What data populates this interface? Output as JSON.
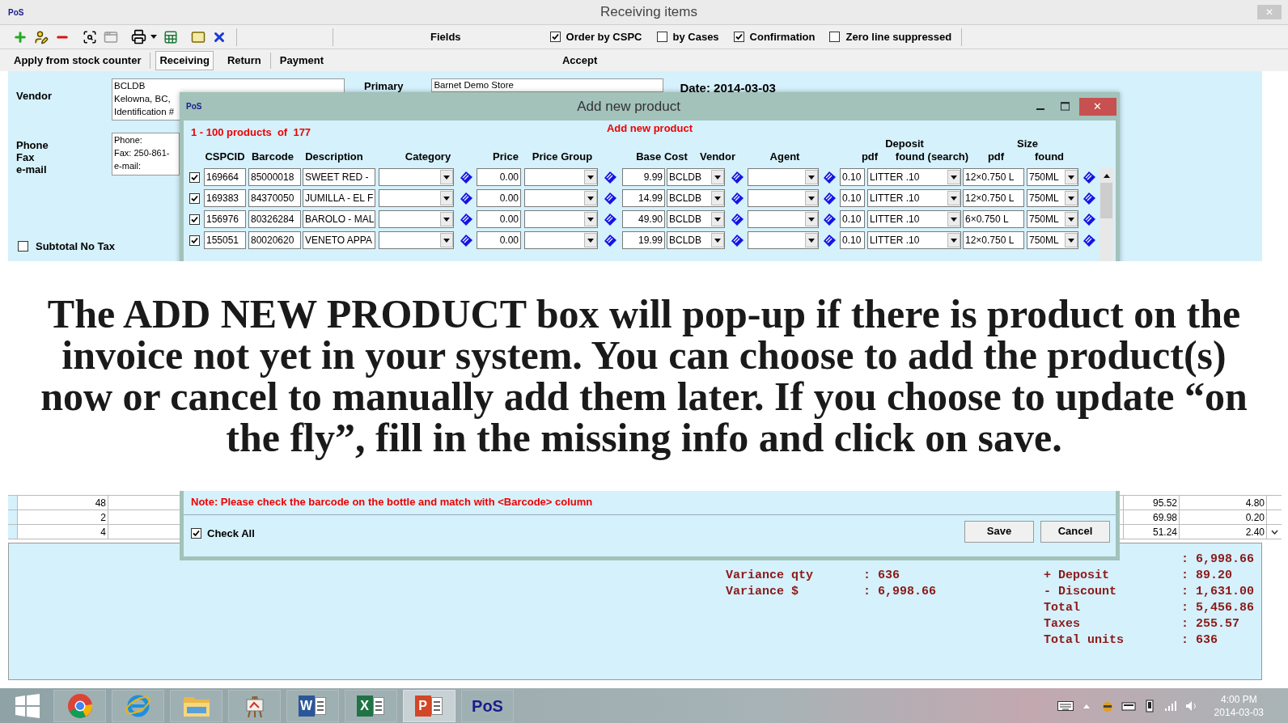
{
  "window": {
    "logo": "PoS",
    "title": "Receiving items",
    "close": "✕"
  },
  "toolbar": {
    "fields_label": "Fields",
    "options": [
      {
        "label": "Order by CSPC",
        "checked": true
      },
      {
        "label": "by Cases",
        "checked": false
      },
      {
        "label": "Confirmation",
        "checked": true
      },
      {
        "label": "Zero line suppressed",
        "checked": false
      }
    ]
  },
  "tabs": [
    {
      "label": "Apply from stock counter",
      "selected": false
    },
    {
      "label": "Receiving",
      "selected": true
    },
    {
      "label": "Return",
      "selected": false
    },
    {
      "label": "Payment",
      "selected": false
    }
  ],
  "accept_label": "Accept",
  "vendor": {
    "label": "Vendor",
    "lines": [
      "BCLDB",
      "Kelowna, BC,",
      "Identification #"
    ]
  },
  "primary": {
    "label": "Primary",
    "value": "Barnet Demo Store"
  },
  "date": "Date: 2014-03-03",
  "contact": {
    "labels": [
      "Phone",
      "Fax",
      "e-mail"
    ],
    "lines": [
      "Phone:",
      "Fax: 250-861-",
      "e-mail:"
    ]
  },
  "subtotal_no_tax": {
    "label": "Subtotal No Tax",
    "checked": false
  },
  "dialog": {
    "logo": "PoS",
    "title": "Add new product",
    "close": "✕",
    "count": "1 - 100 products  of  177",
    "heading": "Add new product",
    "group_headers": [
      "Deposit",
      "Size"
    ],
    "columns": [
      "CSPCID",
      "Barcode",
      "Description",
      "Category",
      "Price",
      "Price Group",
      "Base Cost",
      "Vendor",
      "Agent",
      "pdf",
      "found (search)",
      "pdf",
      "found"
    ],
    "rows": [
      {
        "checked": true,
        "cspcid": "169664",
        "barcode": "85000018",
        "description": "SWEET RED -",
        "price": "0.00",
        "base_cost": "9.99",
        "vendor": "BCLDB",
        "pdf": "0.10",
        "deposit_found": "LITTER .10",
        "size": "12×0.750 L",
        "size_found": "750ML"
      },
      {
        "checked": true,
        "cspcid": "169383",
        "barcode": "84370050",
        "description": "JUMILLA - EL F",
        "price": "0.00",
        "base_cost": "14.99",
        "vendor": "BCLDB",
        "pdf": "0.10",
        "deposit_found": "LITTER .10",
        "size": "12×0.750 L",
        "size_found": "750ML"
      },
      {
        "checked": true,
        "cspcid": "156976",
        "barcode": "80326284",
        "description": "BAROLO - MAL",
        "price": "0.00",
        "base_cost": "49.90",
        "vendor": "BCLDB",
        "pdf": "0.10",
        "deposit_found": "LITTER .10",
        "size": "6×0.750 L",
        "size_found": "750ML"
      },
      {
        "checked": true,
        "cspcid": "155051",
        "barcode": "80020620",
        "description": "VENETO APPA",
        "price": "0.00",
        "base_cost": "19.99",
        "vendor": "BCLDB",
        "pdf": "0.10",
        "deposit_found": "LITTER .10",
        "size": "12×0.750 L",
        "size_found": "750ML"
      }
    ],
    "note": "Note: Please check the barcode on the bottle and match with <Barcode> column",
    "check_all": {
      "label": "Check All",
      "checked": true
    },
    "buttons": [
      "Save",
      "Cancel"
    ]
  },
  "caption": "The ADD NEW PRODUCT box will pop-up if there is product on the invoice not yet in your system. You can choose to add the product(s) now or cancel to manually add them later. If you choose to update “on the fly”, fill in the missing info and click on save.",
  "back_table": {
    "rows": [
      {
        "column_1": "48",
        "column_2": "95.52",
        "column_3": "4.80"
      },
      {
        "column_1": "2",
        "column_2": "69.98",
        "column_3": "0.20"
      },
      {
        "column_1": "4",
        "column_2": "51.24",
        "column_3": "2.40"
      }
    ]
  },
  "totals": {
    "variance": [
      {
        "label": "Variance qty",
        "value": ": 636"
      },
      {
        "label": "Variance $",
        "value": ": 6,998.66"
      }
    ],
    "summary": [
      {
        "value": ": 6,998.66"
      },
      {
        "label": "+ Deposit",
        "value": ": 89.20"
      },
      {
        "label": "- Discount",
        "value": ": 1,631.00"
      },
      {
        "label": "Total",
        "value": ": 5,456.86"
      },
      {
        "label": "Taxes",
        "value": ": 255.57"
      },
      {
        "label": "Total units",
        "value": ": 636"
      }
    ]
  },
  "taskbar": {
    "apps": [
      {
        "kind": "chrome",
        "selected": false
      },
      {
        "kind": "ie",
        "selected": false
      },
      {
        "kind": "folder",
        "selected": false
      },
      {
        "kind": "easel",
        "selected": false
      },
      {
        "kind": "word",
        "label": "W",
        "selected": false
      },
      {
        "kind": "excel",
        "label": "X",
        "selected": false
      },
      {
        "kind": "powerpoint",
        "label": "P",
        "selected": true
      },
      {
        "kind": "pos",
        "label": "PoS",
        "selected": false
      }
    ],
    "time": "4:00 PM",
    "date": "2014-03-03"
  }
}
